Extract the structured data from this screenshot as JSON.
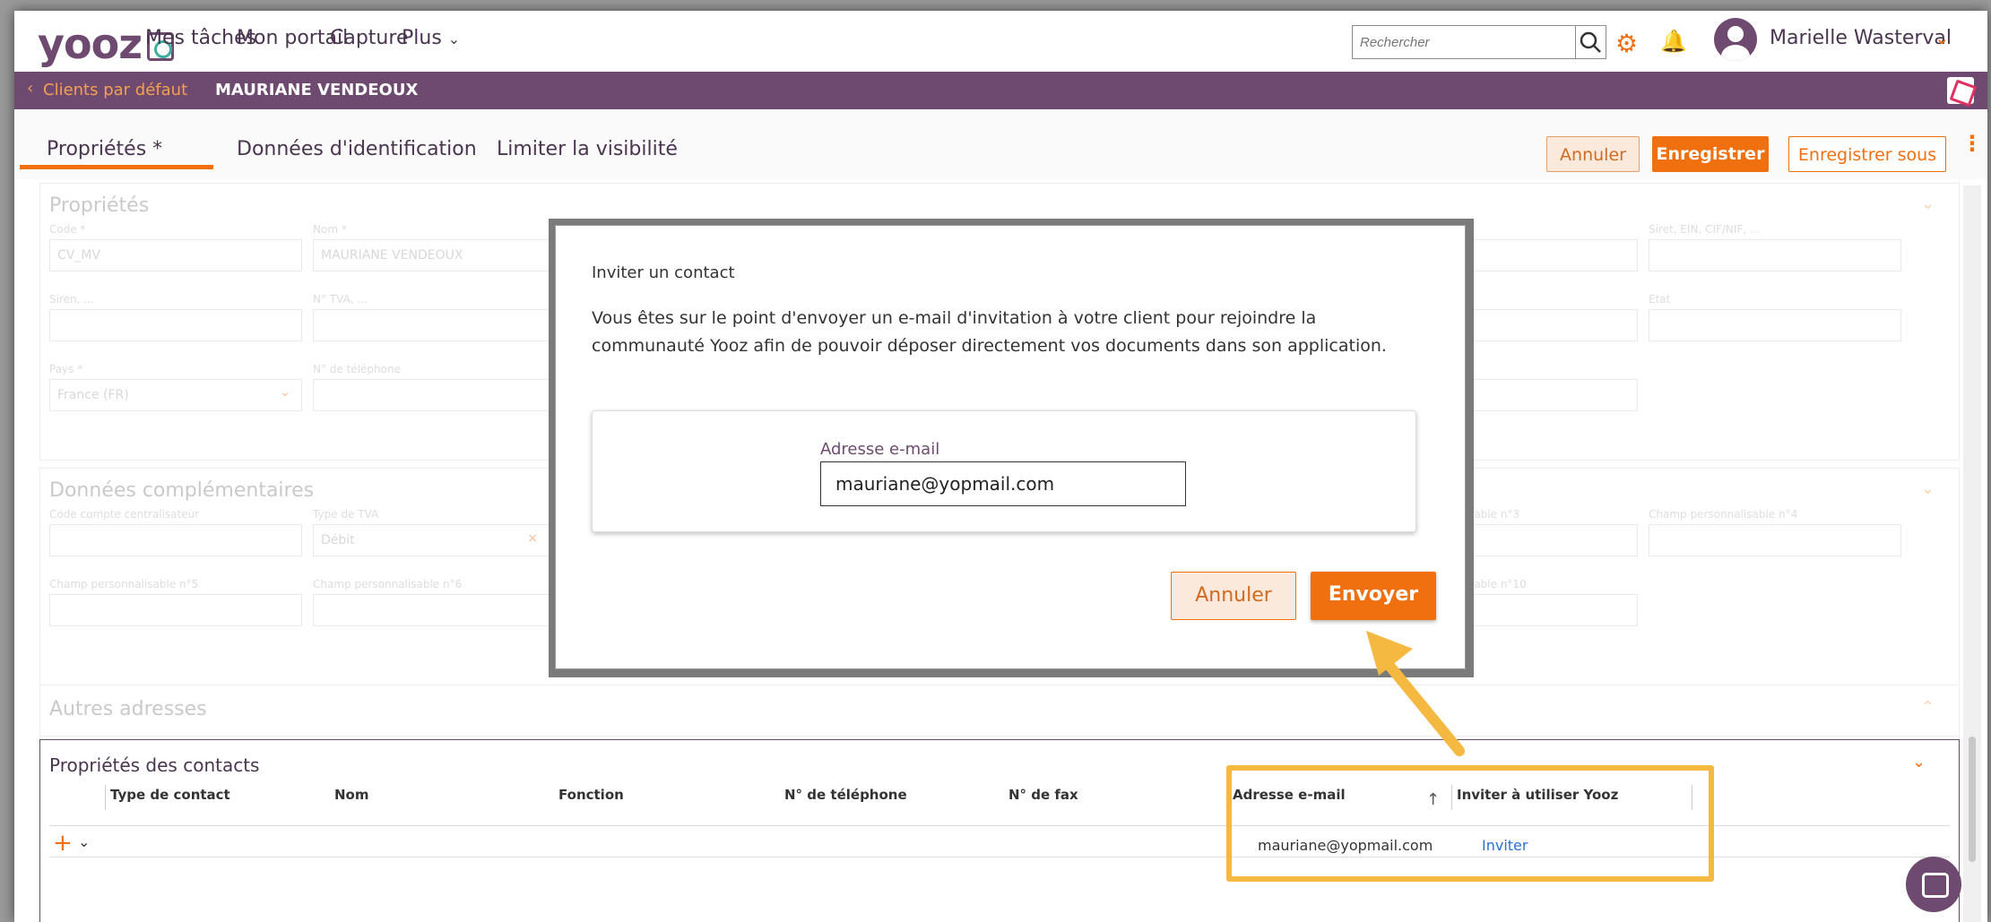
{
  "header": {
    "logo_text": "yooz",
    "nav": [
      "Mes tâches",
      "Mon portail",
      "Capture",
      "Plus"
    ],
    "search_placeholder": "Rechercher",
    "username": "Marielle Wasterval"
  },
  "breadcrumb": {
    "back_glyph": "‹",
    "parent": "Clients par défaut",
    "current": "MAURIANE VENDEOUX"
  },
  "tabs": {
    "items": [
      "Propriétés *",
      "Données d'identification",
      "Limiter la visibilité"
    ],
    "active": "Propriétés *"
  },
  "actions": {
    "cancel": "Annuler",
    "save": "Enregistrer",
    "save_as": "Enregistrer sous"
  },
  "form": {
    "proprietes": {
      "title": "Propriétés",
      "labels": {
        "code": "Code *",
        "nom": "Nom *",
        "siret": "Siret, EIN, CIF/NIF, ...",
        "siren": "Siren, ...",
        "tva": "N° TVA, ...",
        "etat": "Etat",
        "pays": "Pays *",
        "telephone": "N° de téléphone"
      },
      "values": {
        "code": "CV_MV",
        "nom": "MAURIANE VENDEOUX",
        "pays": "France (FR)"
      }
    },
    "complementaires": {
      "title": "Données complémentaires",
      "labels": {
        "compte": "Code compte centralisateur",
        "type_tva": "Type de TVA",
        "perso3": "...nalisable n°3",
        "perso4": "Champ personnalisable n°4",
        "perso5": "Champ personnalisable n°5",
        "perso6": "Champ personnalisable n°6",
        "perso10": "...nalisable n°10"
      },
      "values": {
        "type_tva": "Débit"
      }
    },
    "autres_adresses": {
      "title": "Autres adresses"
    }
  },
  "contacts": {
    "title": "Propriétés des contacts",
    "columns": [
      "Type de contact",
      "Nom",
      "Fonction",
      "N° de téléphone",
      "N° de fax",
      "Adresse e-mail",
      "Inviter à utiliser Yooz"
    ],
    "rows": [
      {
        "email": "mauriane@yopmail.com",
        "action": "Inviter"
      }
    ]
  },
  "modal": {
    "title": "Inviter un contact",
    "text": "Vous êtes sur le point d'envoyer un e-mail d'invitation à votre client pour rejoindre la communauté Yooz afin de pouvoir déposer directement vos documents dans son application.",
    "email_label": "Adresse e-mail",
    "email_value": "mauriane@yopmail.com",
    "cancel": "Annuler",
    "send": "Envoyer"
  },
  "colors": {
    "brand_purple": "#6e4a70",
    "accent_orange": "#f07010",
    "highlight_yellow": "#f5b942",
    "link_blue": "#2a6fd6"
  }
}
